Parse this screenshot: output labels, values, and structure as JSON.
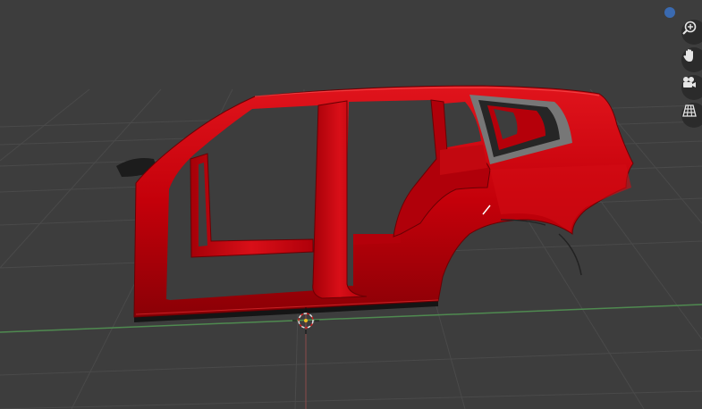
{
  "app": "3D Viewport",
  "viewport": {
    "background_color": "#3d3d3d",
    "grid_color": "#4a4a4a",
    "x_axis_color": "#4f8a50",
    "z_axis_color": "#8a4a4a",
    "model_color": "#c4000a",
    "model_name": "car-body-frame"
  },
  "nav_gizmo": {
    "axis_dot_color": "#3a6ab0",
    "buttons": [
      {
        "name": "zoom",
        "icon": "zoom-in-icon"
      },
      {
        "name": "pan",
        "icon": "hand-icon"
      },
      {
        "name": "camera",
        "icon": "camera-icon"
      },
      {
        "name": "projection",
        "icon": "grid-icon"
      }
    ]
  }
}
